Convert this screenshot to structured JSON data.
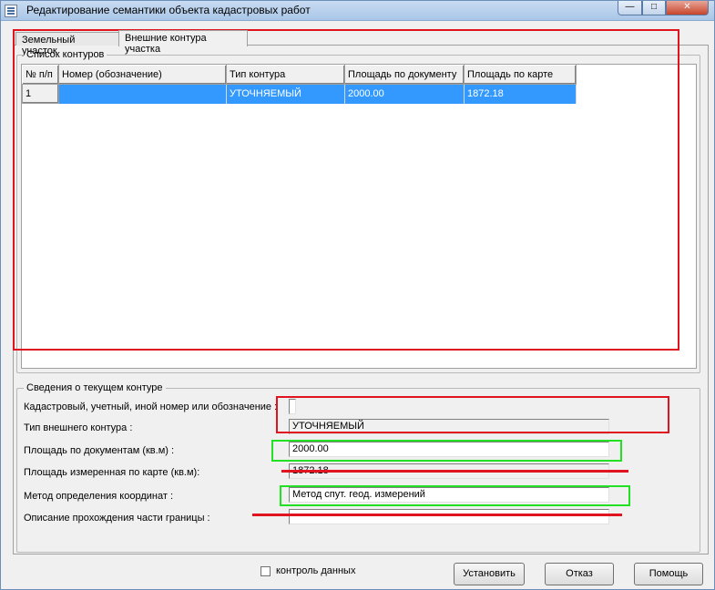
{
  "window": {
    "title": "Редактирование семантики объекта кадастровых работ",
    "minimize": "—",
    "maximize": "□",
    "close": "✕"
  },
  "tabs": [
    {
      "label": "Земельный участок"
    },
    {
      "label": "Внешние контура участка"
    }
  ],
  "contours": {
    "legend": "Список контуров",
    "columns": [
      "№ п/п",
      "Номер (обозначение)",
      "Тип контура",
      "Площадь по документу",
      "Площадь по карте"
    ],
    "rows": [
      {
        "num": "1",
        "designation": "",
        "type": "УТОЧНЯЕМЫЙ",
        "area_doc": "2000.00",
        "area_map": "1872.18"
      }
    ]
  },
  "current": {
    "legend": "Сведения о текущем контуре",
    "cad_label": "Кадастровый, учетный, иной номер или обозначение :",
    "cad_value": "",
    "type_label": "Тип внешнего контура :",
    "type_value": "УТОЧНЯЕМЫЙ",
    "area_doc_label": "Площадь по документам  (кв.м) :",
    "area_doc_value": "2000.00",
    "area_map_label": "Площадь измеренная по карте (кв.м):",
    "area_map_value": "1872.18",
    "method_label": "Метод определения координат :",
    "method_value": "Метод спут. геод. измерений",
    "desc_label": "Описание прохождения части границы :",
    "desc_value": ""
  },
  "footer": {
    "check_label": "контроль данных",
    "check_checked": false,
    "apply_label": "Установить",
    "cancel_label": "Отказ",
    "help_label": "Помощь"
  },
  "colors": {
    "annotation_red": "#e0141e",
    "annotation_green": "#22e022",
    "selection": "#3399ff"
  }
}
